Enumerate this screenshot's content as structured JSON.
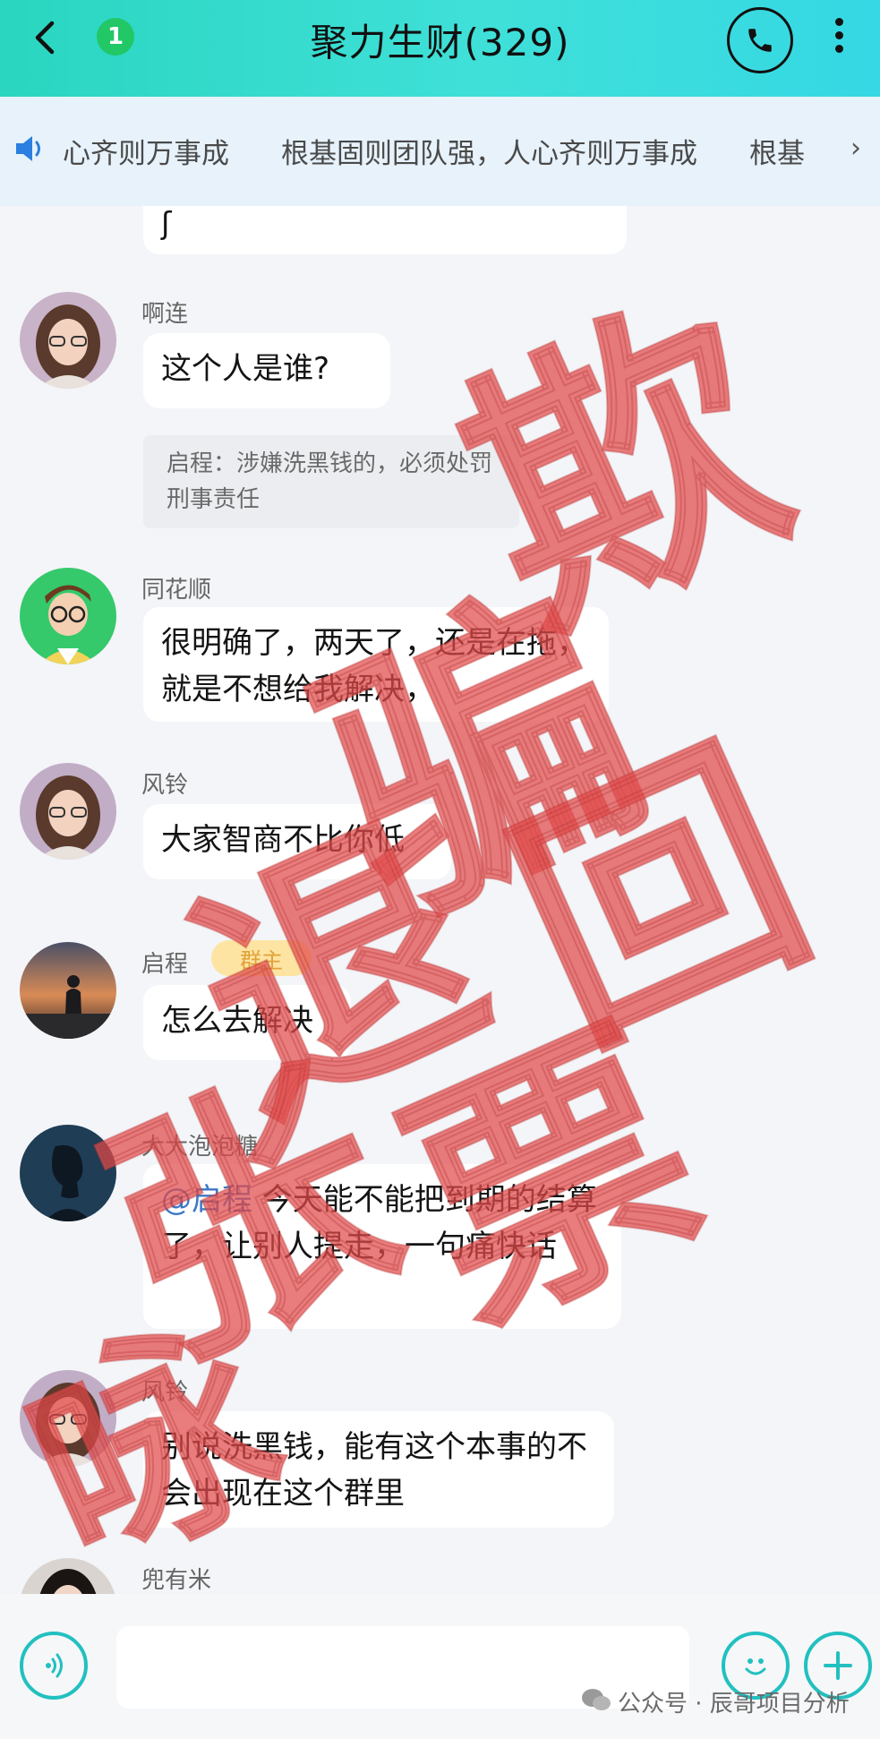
{
  "header": {
    "title": "聚力生财(329)",
    "unread_count": "1"
  },
  "notice": {
    "items": [
      "心齐则万事成",
      "根基固则团队强，人心齐则万事成",
      "根基"
    ]
  },
  "messages": [
    {
      "partial_text": "ʃ"
    },
    {
      "sender": "啊连",
      "text": "这个人是谁?",
      "quote": "启程：涉嫌洗黑钱的，必须处罚刑事责任",
      "avatar": "girl-avatar"
    },
    {
      "sender": "同花顺",
      "text": "很明确了，两天了，还是在拖，就是不想给我解决，",
      "avatar": "cartoon-boy-avatar"
    },
    {
      "sender": "风铃",
      "text": "大家智商不比你低",
      "avatar": "girl-avatar"
    },
    {
      "sender": "启程",
      "role_badge": "群主",
      "text": "怎么去解决",
      "avatar": "sunset-silhouette-avatar"
    },
    {
      "sender": "大大泡泡糖",
      "mention": "@启程",
      "text": " 今天能不能把到期的结算了，让别人提走，一句痛快话",
      "avatar": "dark-profile-avatar"
    },
    {
      "sender": "风铃",
      "text": "别说洗黑钱，能有这个本事的不会出现在这个群里",
      "avatar": "girl-avatar"
    },
    {
      "sender": "兜有米",
      "text": "",
      "avatar": "woman-photo-avatar"
    }
  ],
  "watermark": {
    "stamp": [
      "欺",
      "骗",
      "退",
      "回",
      "张",
      "票",
      "咏"
    ],
    "footer_text": "公众号 · 辰哥项目分析"
  },
  "colors": {
    "header": "#35dccf",
    "stamp": "#e04b4b",
    "owner_badge_bg": "#fde4a2"
  }
}
